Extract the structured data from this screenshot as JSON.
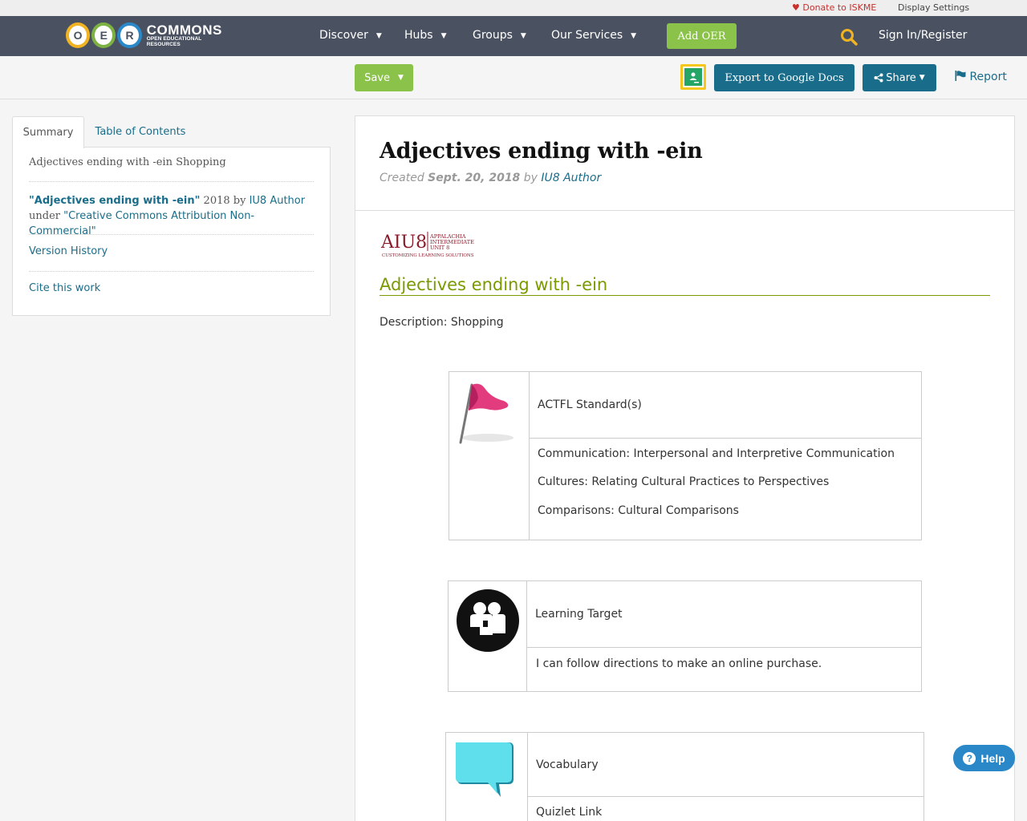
{
  "utility": {
    "donate": "Donate to ISKME",
    "display_settings": "Display Settings"
  },
  "nav": {
    "logo_letters": [
      "O",
      "E",
      "R"
    ],
    "logo_word": "COMMONS",
    "logo_tagline": "OPEN EDUCATIONAL RESOURCES",
    "items": [
      {
        "label": "Discover"
      },
      {
        "label": "Hubs"
      },
      {
        "label": "Groups"
      },
      {
        "label": "Our Services"
      }
    ],
    "add_oer": "Add OER",
    "signin": "Sign In/Register"
  },
  "toolbar": {
    "save": "Save",
    "export": "Export to Google Docs",
    "share": "Share",
    "report": "Report"
  },
  "sidebar": {
    "tabs": [
      {
        "label": "Summary"
      },
      {
        "label": "Table of Contents"
      }
    ],
    "summary_text": "Adjectives ending with -ein Shopping",
    "attribution": {
      "title": "\"Adjectives ending with -ein\"",
      "year_by": " 2018 by ",
      "author": "IU8 Author",
      "under": "under ",
      "license": "\"Creative Commons Attribution Non-Commercial\""
    },
    "version_history": "Version History",
    "cite": "Cite this work"
  },
  "content": {
    "title": "Adjectives ending with -ein",
    "created_label": "Created ",
    "created_date": "Sept. 20, 2018",
    "by_label": " by ",
    "author": "IU8 Author",
    "logo_text": {
      "main": "AIU8",
      "line1": "APPALACHIA",
      "line2": "INTERMEDIATE",
      "line3": "UNIT 8",
      "tagline": "CUSTOMIZING LEARNING SOLUTIONS"
    },
    "heading": "Adjectives ending with -ein",
    "description": "Description: Shopping",
    "cards": [
      {
        "header": "ACTFL Standard(s)",
        "lines": [
          "Communication: Interpersonal and Interpretive Communication",
          "Cultures: Relating Cultural Practices to Perspectives",
          "Comparisons: Cultural Comparisons"
        ]
      },
      {
        "header": "Learning Target",
        "lines": [
          "I can follow directions to make an online purchase."
        ]
      },
      {
        "header": "Vocabulary",
        "link": "Quizlet Link"
      }
    ]
  },
  "help": "Help",
  "colors": {
    "nav_bg": "#4a5262",
    "green": "#8bc34a",
    "teal": "#1a6d8a",
    "heading_green": "#7a9a00",
    "help_blue": "#2b88c8"
  }
}
